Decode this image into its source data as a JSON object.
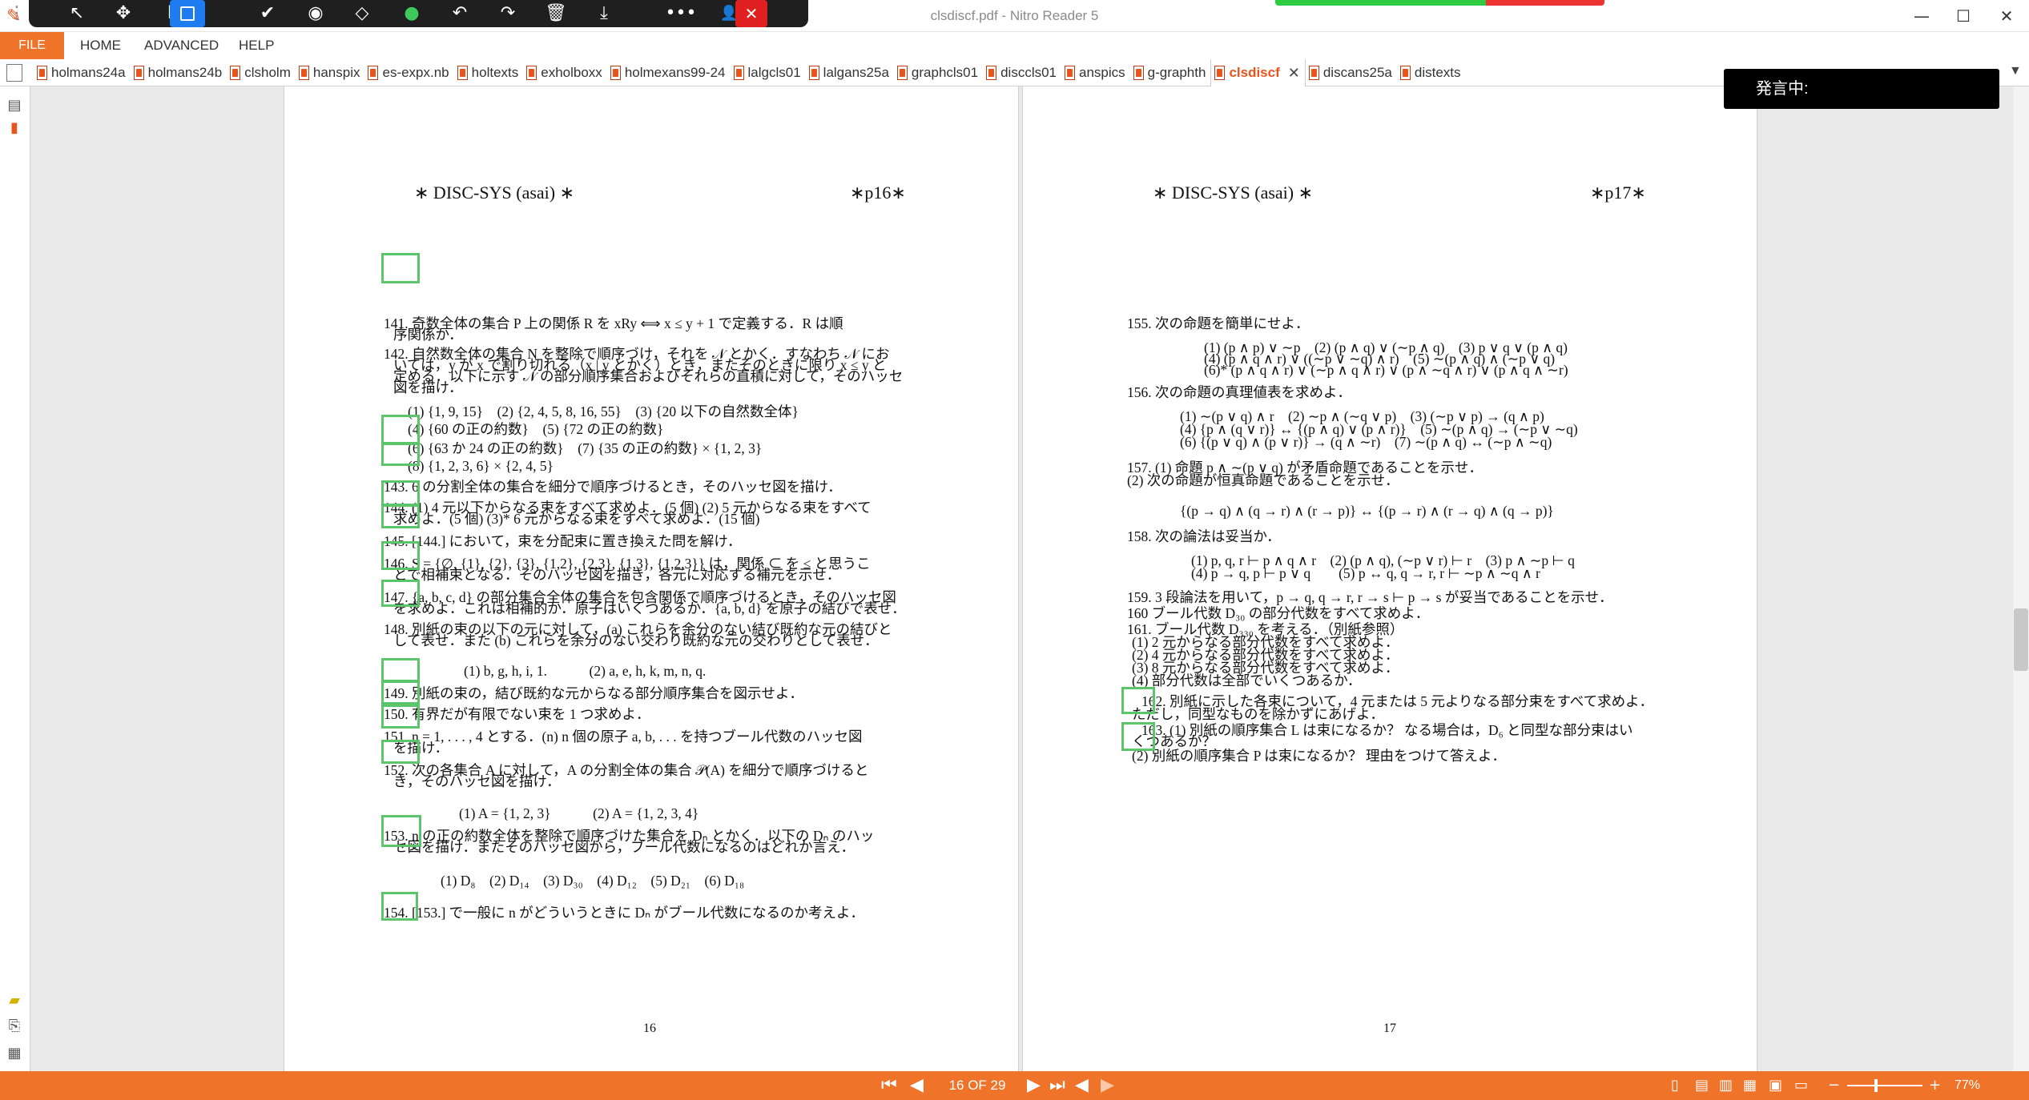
{
  "window": {
    "title": "clsdiscf.pdf - Nitro Reader 5",
    "minimize": "—",
    "maximize": "☐",
    "close": "✕"
  },
  "menu": {
    "file": "FILE",
    "home": "HOME",
    "advanced": "ADVANCED",
    "help": "HELP"
  },
  "tabs": [
    {
      "label": "holmans24a"
    },
    {
      "label": "holmans24b"
    },
    {
      "label": "clsholm"
    },
    {
      "label": "hanspix"
    },
    {
      "label": "es-expx.nb"
    },
    {
      "label": "holtexts"
    },
    {
      "label": "exholboxx"
    },
    {
      "label": "holmexans99-24"
    },
    {
      "label": "lalgcls01"
    },
    {
      "label": "lalgans25a"
    },
    {
      "label": "graphcls01"
    },
    {
      "label": "disccls01"
    },
    {
      "label": "anspics"
    },
    {
      "label": "g-graphth"
    },
    {
      "label": "clsdiscf",
      "active": true
    },
    {
      "label": "discans25a"
    },
    {
      "label": "distexts"
    }
  ],
  "overlay": {
    "speaking": "発言中:"
  },
  "left_page": {
    "header_left": "∗ DISC-SYS (asai) ∗",
    "header_right": "∗p16∗",
    "footer": "16",
    "lines": [
      "141. 奇数全体の集合 P 上の関係 R を xRy ⟺ x ≤ y + 1 で定義する．R は順",
      "序関係か．",
      "142. 自然数全体の集合 N を整除で順序づけ，それを 𝒩 とかく．すなわち 𝒩 にお",
      "いては，y が x で割り切れる（x | y とかく）とき，またそのときに限り x ≤ y と",
      "定める．以下に示す 𝒩 の部分順序集合およびそれらの直積に対して，そのハッセ",
      "図を描け．",
      "(1) {1, 9, 15}　(2) {2, 4, 5, 8, 16, 55}　(3) {20 以下の自然数全体}",
      "(4) {60 の正の約数}　(5) {72 の正の約数}",
      "(6) {63 か 24 の正の約数}　(7) {35 の正の約数} × {1, 2, 3}",
      "(8) {1, 2, 3, 6} × {2, 4, 5}",
      "143. 6 の分割全体の集合を細分で順序づけるとき，そのハッセ図を描け．",
      "144. (1) 4 元以下からなる束をすべて求めよ．(5 個) (2) 5 元からなる束をすべて",
      "求めよ．(5 個) (3)* 6 元からなる束をすべて求めよ．(15 個)",
      "145. [144.] において，束を分配束に置き換えた問を解け．",
      "146. S = {∅, {1}, {2}, {3}, {1,2}, {2,3}, {1,3}, {1,2,3}} は，関係 ⊂ を ≤ と思うこ",
      "とで相補束となる．そのハッセ図を描き，各元に対応する補元を示せ．",
      "147. {a, b, c, d} の部分集合全体の集合を包含関係で順序づけるとき，そのハッセ図",
      "を求めよ．これは相補的か．原子はいくつあるか．{a, b, d} を原子の結びで表せ．",
      "148. 別紙の束の以下の元に対して，(a) これらを余分のない結び既約な元の結びと",
      "して表せ．また (b) これらを余分のない交わり既約な元の交わりとして表せ．",
      "(1) b, g, h, i, 1.　　　(2) a, e, h, k, m, n, q.",
      "149. 別紙の束の，結び既約な元からなる部分順序集合を図示せよ．",
      "150. 有界だが有限でない束を 1 つ求めよ．",
      "151. n = 1, . . . , 4 とする．(n) n 個の原子 a, b, . . . を持つブール代数のハッセ図",
      "を描け．",
      "152. 次の各集合 A に対して，A の分割全体の集合 𝒫(A) を細分で順序づけると",
      "き，そのハッセ図を描け．",
      "(1) A = {1, 2, 3}　　　(2) A = {1, 2, 3, 4}",
      "153. n の正の約数全体を整除で順序づけた集合を Dₙ とかく．以下の Dₙ のハッ",
      "セ図を描け．またそのハッセ図から，ブール代数になるのはどれか言え．",
      "(1) D₈　(2) D₁₄　(3) D₃₀　(4) D₁₂　(5) D₂₁　(6) D₁₈",
      "154. [153.] で一般に n がどういうときに Dₙ がブール代数になるのか考えよ．"
    ]
  },
  "right_page": {
    "header_left": "∗ DISC-SYS (asai) ∗",
    "header_right": "∗p17∗",
    "footer": "17",
    "lines": [
      "155. 次の命題を簡単にせよ．",
      "(1) (p ∧ p) ∨ ∼p　(2) (p ∧ q) ∨ (∼p ∧ q)　(3) p ∨ q ∨ (p ∧ q)",
      "(4) (p ∧ q ∧ r) ∨ ((∼p ∨ ∼q) ∧ r)　(5) ∼(p ∧ q) ∧ (∼p ∨ q)",
      "(6)* (p ∧ q ∧ r) ∨ (∼p ∧ q ∧ r) ∨ (p ∧ ∼q ∧ r) ∨ (p ∧ q ∧ ∼r)",
      "156. 次の命題の真理値表を求めよ．",
      "(1) ∼(p ∨ q) ∧ r　(2) ∼p ∧ (∼q ∨ p)　(3) (∼p ∨ p) → (q ∧ p)",
      "(4) {p ∧ (q ∨ r)} ↔ {(p ∧ q) ∨ (p ∧ r)}　(5) ∼(p ∧ q) → (∼p ∨ ∼q)",
      "(6) {(p ∨ q) ∧ (p ∨ r)} → (q ∧ ∼r)　(7) ∼(p ∧ q) ↔ (∼p ∧ ∼q)",
      "157. (1) 命題 p ∧ ∼(p ∨ q) が矛盾命題であることを示せ．",
      "(2) 次の命題が恒真命題であることを示せ．",
      "{(p → q) ∧ (q → r) ∧ (r → p)} ↔ {(p → r) ∧ (r → q) ∧ (q → p)}",
      "158. 次の論法は妥当か．",
      "(1) p, q, r ⊢ p ∧ q ∧ r　(2) (p ∧ q), (∼p ∨ r) ⊢ r　(3) p ∧ ∼p ⊢ q",
      "(4) p → q, p ⊢ p ∨ q　　(5) p ↔ q, q → r, r ⊢ ∼p ∧ ∼q ∧ r",
      "159. 3 段論法を用いて，p → q, q → r, r → s ⊢ p → s が妥当であることを示せ．",
      "160 ブール代数 D₃₀ の部分代数をすべて求めよ．",
      "161. ブール代数 D₃₃₀ を考える．（別紙参照）",
      "(1) 2 元からなる部分代数をすべて求めよ．",
      "(2) 4 元からなる部分代数をすべて求めよ．",
      "(3) 8 元からなる部分代数をすべて求めよ．",
      "(4) 部分代数は全部でいくつあるか．",
      "162. 別紙に示した各束について，4 元または 5 元よりなる部分束をすべて求めよ．",
      "ただし，同型なものを除かずにあげよ．",
      "163. (1) 別紙の順序集合 L は束になるか？ なる場合は，D₆ と同型な部分束はい",
      "くつあるか？",
      "(2) 別紙の順序集合 P は束になるか？ 理由をつけて答えよ．"
    ]
  },
  "navigation": {
    "page_indicator": "16 OF 29",
    "zoom": "77%"
  }
}
